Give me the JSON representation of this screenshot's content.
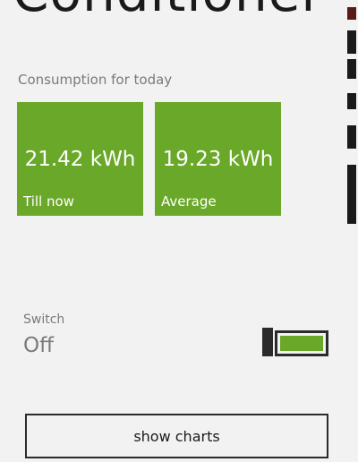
{
  "header": {
    "title": "Conditioner"
  },
  "consumption": {
    "section_label": "Consumption for today",
    "tiles": [
      {
        "value": "21.42 kWh",
        "caption": "Till now"
      },
      {
        "value": "19.23 kWh",
        "caption": "Average"
      }
    ]
  },
  "switch": {
    "label": "Switch",
    "state": "Off",
    "level": 1.0
  },
  "actions": {
    "charts_label": "show charts"
  },
  "colors": {
    "accent": "#6aa82a",
    "background": "#f2f2f2",
    "dark": "#2b2b2b",
    "muted": "#7a7a7a"
  }
}
